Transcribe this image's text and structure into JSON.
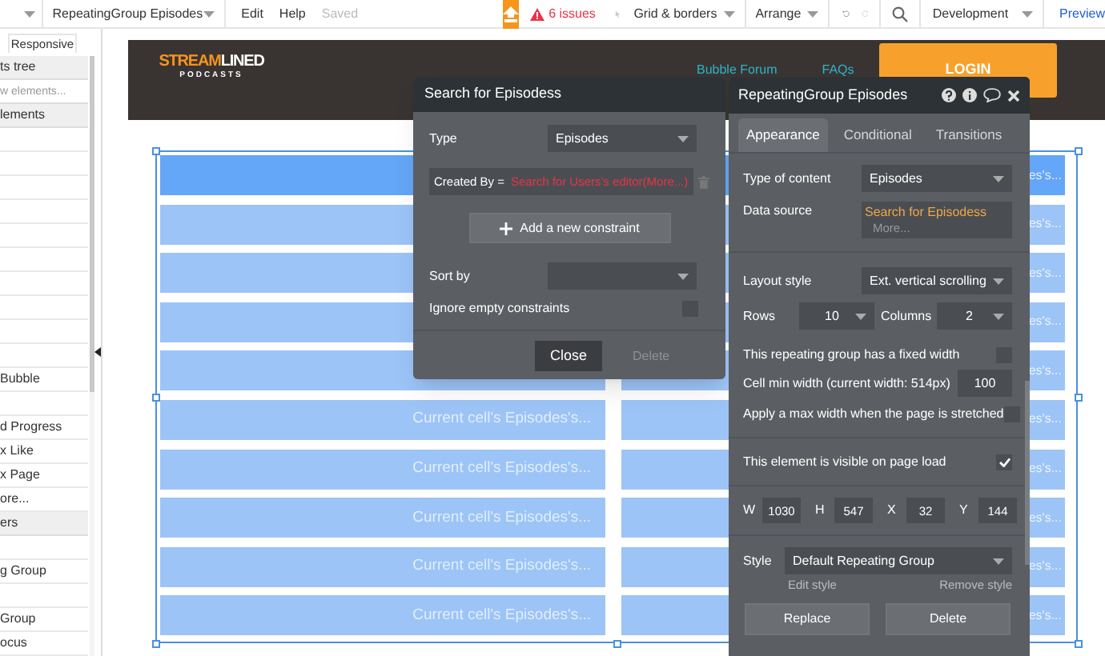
{
  "toolbar": {
    "page_name": "RepeatingGroup Episodes",
    "menus": [
      "Edit",
      "Help"
    ],
    "save_status": "Saved",
    "issues": "6 issues",
    "grid": "Grid & borders",
    "arrange": "Arrange",
    "environment": "Development",
    "preview": "Preview"
  },
  "sidebar": {
    "tab": "Responsive",
    "items": [
      {
        "kind": "header",
        "label": "ts tree"
      },
      {
        "kind": "search",
        "placeholder": "w elements..."
      },
      {
        "kind": "header",
        "label": "lements"
      },
      {
        "kind": "item"
      },
      {
        "kind": "item"
      },
      {
        "kind": "item"
      },
      {
        "kind": "item"
      },
      {
        "kind": "item"
      },
      {
        "kind": "item"
      },
      {
        "kind": "item"
      },
      {
        "kind": "item"
      },
      {
        "kind": "item"
      },
      {
        "kind": "item"
      },
      {
        "kind": "item",
        "label": "Bubble"
      },
      {
        "kind": "item"
      },
      {
        "kind": "item",
        "label": "d Progress"
      },
      {
        "kind": "item",
        "label": "x Like"
      },
      {
        "kind": "item",
        "label": "x Page"
      },
      {
        "kind": "item",
        "label": "ore..."
      },
      {
        "kind": "header",
        "label": "ers"
      },
      {
        "kind": "item"
      },
      {
        "kind": "item",
        "label": "g Group"
      },
      {
        "kind": "item"
      },
      {
        "kind": "item",
        "label": "Group"
      },
      {
        "kind": "item",
        "label": "ocus"
      }
    ]
  },
  "page_header": {
    "logo": {
      "part_1": "STREAM",
      "part_2": "LINED",
      "tagline": "PODCASTS"
    },
    "links": [
      "Bubble Forum",
      "FAQs"
    ],
    "login": "LOGIN"
  },
  "repeating_group": {
    "rows": [
      {
        "selected": true,
        "column_2": "es's..."
      },
      {
        "selected": false,
        "column_2": "es's..."
      },
      {
        "selected": false,
        "column_2": "es's..."
      },
      {
        "selected": false,
        "column_2": "es's..."
      },
      {
        "selected": false,
        "column_2": "es's..."
      },
      {
        "selected": false,
        "column_1": "Current cell's Episodes's...",
        "column_2": "es's..."
      },
      {
        "selected": false,
        "column_1": "Current cell's Episodes's...",
        "column_2": "es's..."
      },
      {
        "selected": false,
        "column_1": "Current cell's Episodes's...",
        "column_2": "es's..."
      },
      {
        "selected": false,
        "column_1": "Current cell's Episodes's...",
        "column_2": "es's..."
      },
      {
        "selected": false,
        "column_1": "Current cell's Episodes's...",
        "column_2": "es's..."
      }
    ]
  },
  "search_dialog": {
    "title": "Search for Episodess",
    "type_label": "Type",
    "type_value": "Episodes",
    "constraint": {
      "field": "Created By =",
      "value": "Search for Users's editor(More...)"
    },
    "add_constraint": "Add a new constraint",
    "sort_label": "Sort by",
    "ignore_empty": {
      "label": "Ignore empty constraints",
      "checked": false
    },
    "close": "Close",
    "delete": {
      "label": "Delete",
      "disabled": true
    }
  },
  "property_editor": {
    "title": "RepeatingGroup Episodes",
    "tabs": [
      {
        "label": "Appearance",
        "selected": true
      },
      {
        "label": "Conditional",
        "selected": false
      },
      {
        "label": "Transitions",
        "selected": false
      }
    ],
    "type_of_content": {
      "label": "Type of content",
      "value": "Episodes"
    },
    "data_source": {
      "label": "Data source",
      "value": "Search for Episodess",
      "more": "More..."
    },
    "layout_style": {
      "label": "Layout style",
      "value": "Ext. vertical scrolling"
    },
    "rows": {
      "label": "Rows",
      "value": "10"
    },
    "columns": {
      "label": "Columns",
      "value": "2"
    },
    "options": [
      {
        "kind": "checkbox",
        "label": "This repeating group has a fixed width",
        "checked": false
      },
      {
        "kind": "input",
        "label": "Cell min width (current width: 514px)",
        "value": "100"
      },
      {
        "kind": "checkbox",
        "label": "Apply a max width when the page is stretched",
        "checked": false
      },
      {
        "kind": "checkbox",
        "label": "This element is visible on page load",
        "checked": true
      }
    ],
    "geometry": [
      {
        "label": "W",
        "value": "1030"
      },
      {
        "label": "H",
        "value": "547"
      },
      {
        "label": "X",
        "value": "32"
      },
      {
        "label": "Y",
        "value": "144"
      }
    ],
    "style": {
      "label": "Style",
      "value": "Default Repeating Group",
      "edit": "Edit style",
      "remove": "Remove style"
    },
    "buttons": [
      "Replace",
      "Delete"
    ]
  }
}
